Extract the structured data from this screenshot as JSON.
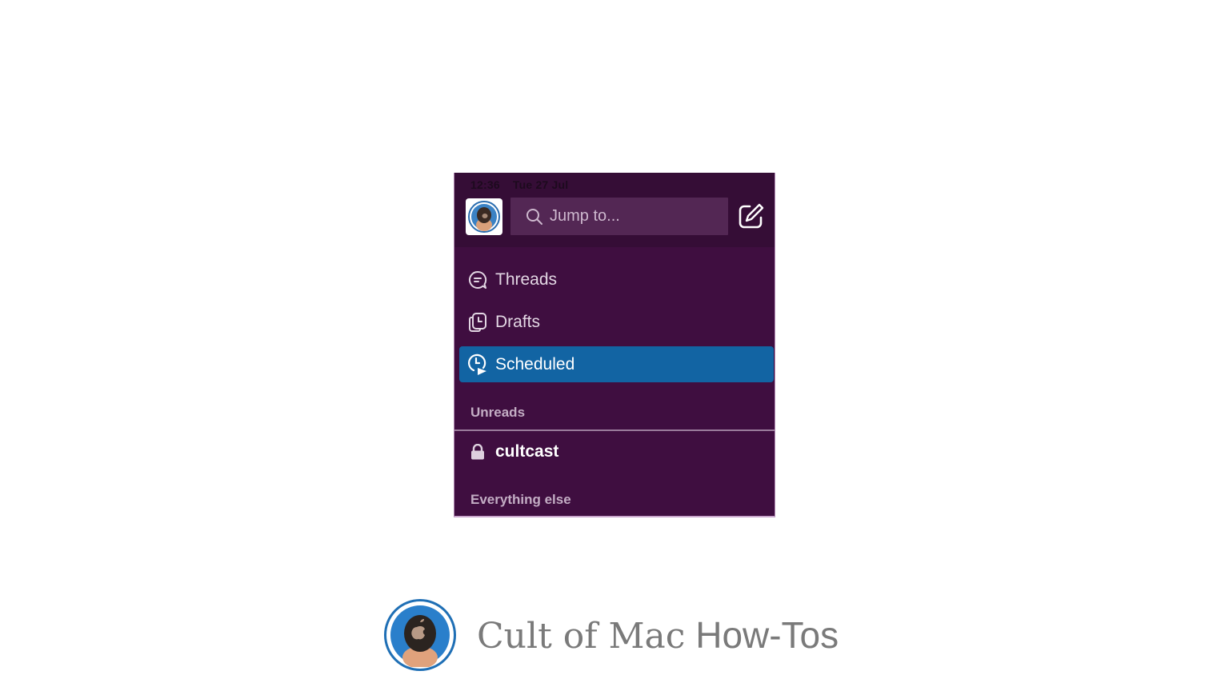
{
  "status_bar": {
    "time": "12:36",
    "date": "Tue 27 Jul"
  },
  "header": {
    "search_placeholder": "Jump to...",
    "icons": {
      "avatar": "user-avatar",
      "search": "search-icon",
      "compose": "compose-icon"
    }
  },
  "nav": {
    "items": [
      {
        "label": "Threads",
        "icon": "threads-icon",
        "active": false
      },
      {
        "label": "Drafts",
        "icon": "drafts-icon",
        "active": false
      },
      {
        "label": "Scheduled",
        "icon": "scheduled-icon",
        "active": true
      }
    ]
  },
  "sections": {
    "unreads": "Unreads",
    "everything_else": "Everything else"
  },
  "channels": [
    {
      "name": "cultcast",
      "icon": "lock-icon",
      "private": true
    }
  ],
  "colors": {
    "sidebar_bg": "#3f0e40",
    "header_bg": "#350d36",
    "active_item": "#1264a3",
    "search_bg": "#532754"
  },
  "brand": {
    "name_strong": "Cult of Mac",
    "name_light": "How-Tos"
  }
}
